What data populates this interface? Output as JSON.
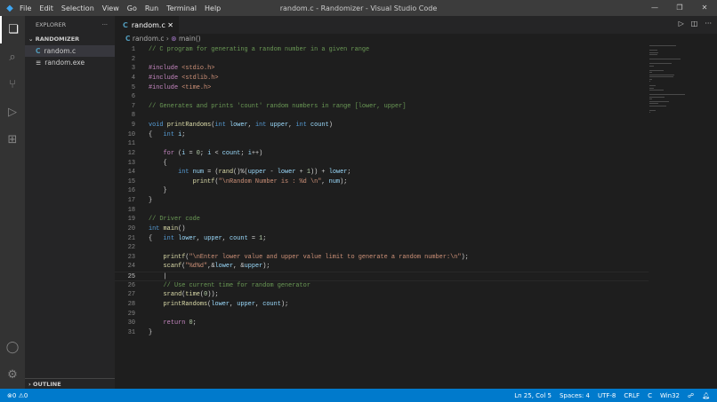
{
  "titlebar": {
    "title": "random.c - Randomizer - Visual Studio Code",
    "menu": [
      "File",
      "Edit",
      "Selection",
      "View",
      "Go",
      "Run",
      "Terminal",
      "Help"
    ]
  },
  "sidebar": {
    "header": "EXPLORER",
    "folder": "RANDOMIZER",
    "files": [
      {
        "icon": "C",
        "name": "random.c"
      },
      {
        "icon": "≡",
        "name": "random.exe"
      }
    ],
    "outline": "OUTLINE"
  },
  "tab": {
    "icon": "C",
    "label": "random.c"
  },
  "breadcrumb": {
    "file": "random.c",
    "symbol": "main()"
  },
  "code": [
    [
      [
        "// C program for generating a random number in a given range",
        "cm"
      ]
    ],
    [],
    [
      [
        "#include ",
        "pp"
      ],
      [
        "<stdio.h>",
        "st"
      ]
    ],
    [
      [
        "#include ",
        "pp"
      ],
      [
        "<stdlib.h>",
        "st"
      ]
    ],
    [
      [
        "#include ",
        "pp"
      ],
      [
        "<time.h>",
        "st"
      ]
    ],
    [],
    [
      [
        "// Generates and prints 'count' random numbers in range [lower, upper]",
        "cm"
      ]
    ],
    [],
    [
      [
        "void ",
        "kw"
      ],
      [
        "printRandoms",
        "fn"
      ],
      [
        "(",
        "pl"
      ],
      [
        "int ",
        "kw"
      ],
      [
        "lower",
        "vr"
      ],
      [
        ", ",
        "pl"
      ],
      [
        "int ",
        "kw"
      ],
      [
        "upper",
        "vr"
      ],
      [
        ", ",
        "pl"
      ],
      [
        "int ",
        "kw"
      ],
      [
        "count",
        "vr"
      ],
      [
        ")",
        "pl"
      ]
    ],
    [
      [
        "{   ",
        "pl"
      ],
      [
        "int ",
        "kw"
      ],
      [
        "i",
        "vr"
      ],
      [
        ";",
        "pl"
      ]
    ],
    [],
    [
      [
        "    ",
        "pl"
      ],
      [
        "for ",
        "ctl"
      ],
      [
        "(",
        "pl"
      ],
      [
        "i",
        "vr"
      ],
      [
        " = ",
        "pl"
      ],
      [
        "0",
        "nu"
      ],
      [
        "; ",
        "pl"
      ],
      [
        "i",
        "vr"
      ],
      [
        " < ",
        "pl"
      ],
      [
        "count",
        "vr"
      ],
      [
        "; ",
        "pl"
      ],
      [
        "i",
        "vr"
      ],
      [
        "++)",
        "pl"
      ]
    ],
    [
      [
        "    {",
        "pl"
      ]
    ],
    [
      [
        "        ",
        "pl"
      ],
      [
        "int ",
        "kw"
      ],
      [
        "num",
        "vr"
      ],
      [
        " = (",
        "pl"
      ],
      [
        "rand",
        "fn"
      ],
      [
        "()%(",
        "pl"
      ],
      [
        "upper",
        "vr"
      ],
      [
        " - ",
        "pl"
      ],
      [
        "lower",
        "vr"
      ],
      [
        " + ",
        "pl"
      ],
      [
        "1",
        "nu"
      ],
      [
        ")) + ",
        "pl"
      ],
      [
        "lower",
        "vr"
      ],
      [
        ";",
        "pl"
      ]
    ],
    [
      [
        "            ",
        "pl"
      ],
      [
        "printf",
        "fn"
      ],
      [
        "(",
        "pl"
      ],
      [
        "\"\\nRandom Number is : %d \\n\"",
        "st"
      ],
      [
        ", ",
        "pl"
      ],
      [
        "num",
        "vr"
      ],
      [
        ");",
        "pl"
      ]
    ],
    [
      [
        "    }",
        "pl"
      ]
    ],
    [
      [
        "}",
        "pl"
      ]
    ],
    [],
    [
      [
        "// Driver code",
        "cm"
      ]
    ],
    [
      [
        "int ",
        "kw"
      ],
      [
        "main",
        "fn"
      ],
      [
        "()",
        "pl"
      ]
    ],
    [
      [
        "{   ",
        "pl"
      ],
      [
        "int ",
        "kw"
      ],
      [
        "lower",
        "vr"
      ],
      [
        ", ",
        "pl"
      ],
      [
        "upper",
        "vr"
      ],
      [
        ", ",
        "pl"
      ],
      [
        "count",
        "vr"
      ],
      [
        " = ",
        "pl"
      ],
      [
        "1",
        "nu"
      ],
      [
        ";",
        "pl"
      ]
    ],
    [],
    [
      [
        "    ",
        "pl"
      ],
      [
        "printf",
        "fn"
      ],
      [
        "(",
        "pl"
      ],
      [
        "\"\\nEnter lower value and upper value limit to generate a random number:\\n\"",
        "st"
      ],
      [
        ");",
        "pl"
      ]
    ],
    [
      [
        "    ",
        "pl"
      ],
      [
        "scanf",
        "fn"
      ],
      [
        "(",
        "pl"
      ],
      [
        "\"%d%d\"",
        "st"
      ],
      [
        ",&",
        "pl"
      ],
      [
        "lower",
        "vr"
      ],
      [
        ", &",
        "pl"
      ],
      [
        "upper",
        "vr"
      ],
      [
        ");",
        "pl"
      ]
    ],
    [
      [
        "    |",
        "pl"
      ]
    ],
    [
      [
        "    ",
        "pl"
      ],
      [
        "// Use current time for random generator",
        "cm"
      ]
    ],
    [
      [
        "    ",
        "pl"
      ],
      [
        "srand",
        "fn"
      ],
      [
        "(",
        "pl"
      ],
      [
        "time",
        "fn"
      ],
      [
        "(",
        "pl"
      ],
      [
        "0",
        "nu"
      ],
      [
        "));",
        "pl"
      ]
    ],
    [
      [
        "    ",
        "pl"
      ],
      [
        "printRandoms",
        "fn"
      ],
      [
        "(",
        "pl"
      ],
      [
        "lower",
        "vr"
      ],
      [
        ", ",
        "pl"
      ],
      [
        "upper",
        "vr"
      ],
      [
        ", ",
        "pl"
      ],
      [
        "count",
        "vr"
      ],
      [
        ");",
        "pl"
      ]
    ],
    [],
    [
      [
        "    ",
        "pl"
      ],
      [
        "return ",
        "ctl"
      ],
      [
        "0",
        "nu"
      ],
      [
        ";",
        "pl"
      ]
    ],
    [
      [
        "}",
        "pl"
      ]
    ]
  ],
  "current_line": 25,
  "statusbar": {
    "errors": "0",
    "warnings": "0",
    "position": "Ln 25, Col 5",
    "spaces": "Spaces: 4",
    "encoding": "UTF-8",
    "eol": "CRLF",
    "language": "C",
    "platform": "Win32"
  }
}
